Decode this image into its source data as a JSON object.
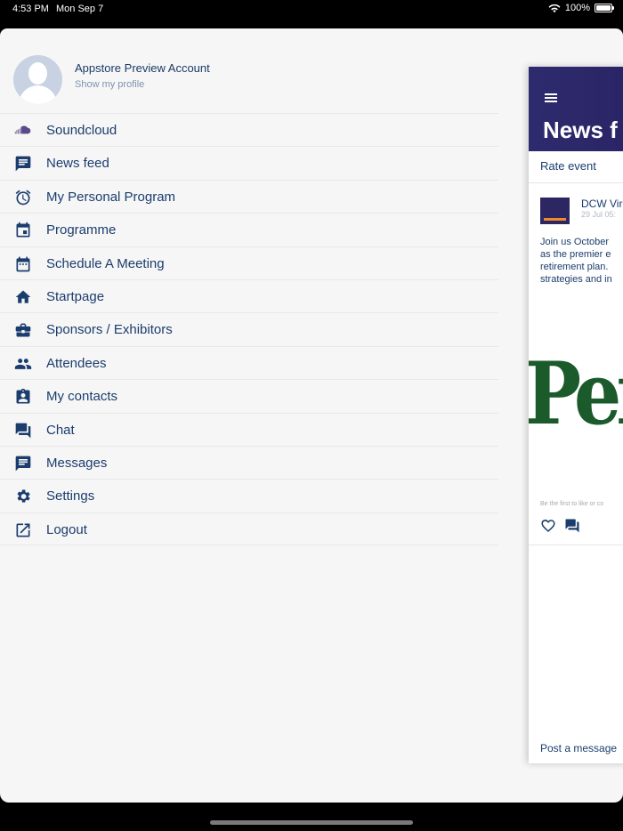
{
  "status_bar": {
    "time": "4:53 PM",
    "date": "Mon Sep 7",
    "battery": "100%",
    "battery_level": 1.0
  },
  "profile": {
    "name": "Appstore Preview Account",
    "subtitle": "Show my profile"
  },
  "menu": {
    "items": [
      {
        "label": "Soundcloud",
        "icon": "soundcloud-icon"
      },
      {
        "label": "News feed",
        "icon": "news-feed-icon"
      },
      {
        "label": "My Personal Program",
        "icon": "alarm-clock-icon"
      },
      {
        "label": "Programme",
        "icon": "calendar-icon"
      },
      {
        "label": "Schedule A Meeting",
        "icon": "calendar-schedule-icon"
      },
      {
        "label": "Startpage",
        "icon": "home-icon"
      },
      {
        "label": "Sponsors / Exhibitors",
        "icon": "briefcase-icon"
      },
      {
        "label": "Attendees",
        "icon": "people-icon"
      },
      {
        "label": "My contacts",
        "icon": "contact-card-icon"
      },
      {
        "label": "Chat",
        "icon": "chat-bubbles-icon"
      },
      {
        "label": "Messages",
        "icon": "message-icon"
      },
      {
        "label": "Settings",
        "icon": "gear-icon"
      },
      {
        "label": "Logout",
        "icon": "logout-icon"
      }
    ]
  },
  "news_panel": {
    "title": "News f",
    "rate_event": "Rate event",
    "post": {
      "author": "DCW Vir",
      "date": "29 Jul 05:",
      "text": "Join us October\nas the premier e\nretirement plan.\nstrategies and in",
      "image_text": "Pen",
      "first_like": "Be the first to like or co"
    },
    "post_message": "Post a message"
  },
  "colors": {
    "accent": "#1b3d6d",
    "header": "#2d2b6e",
    "background": "#f6f6f6"
  }
}
